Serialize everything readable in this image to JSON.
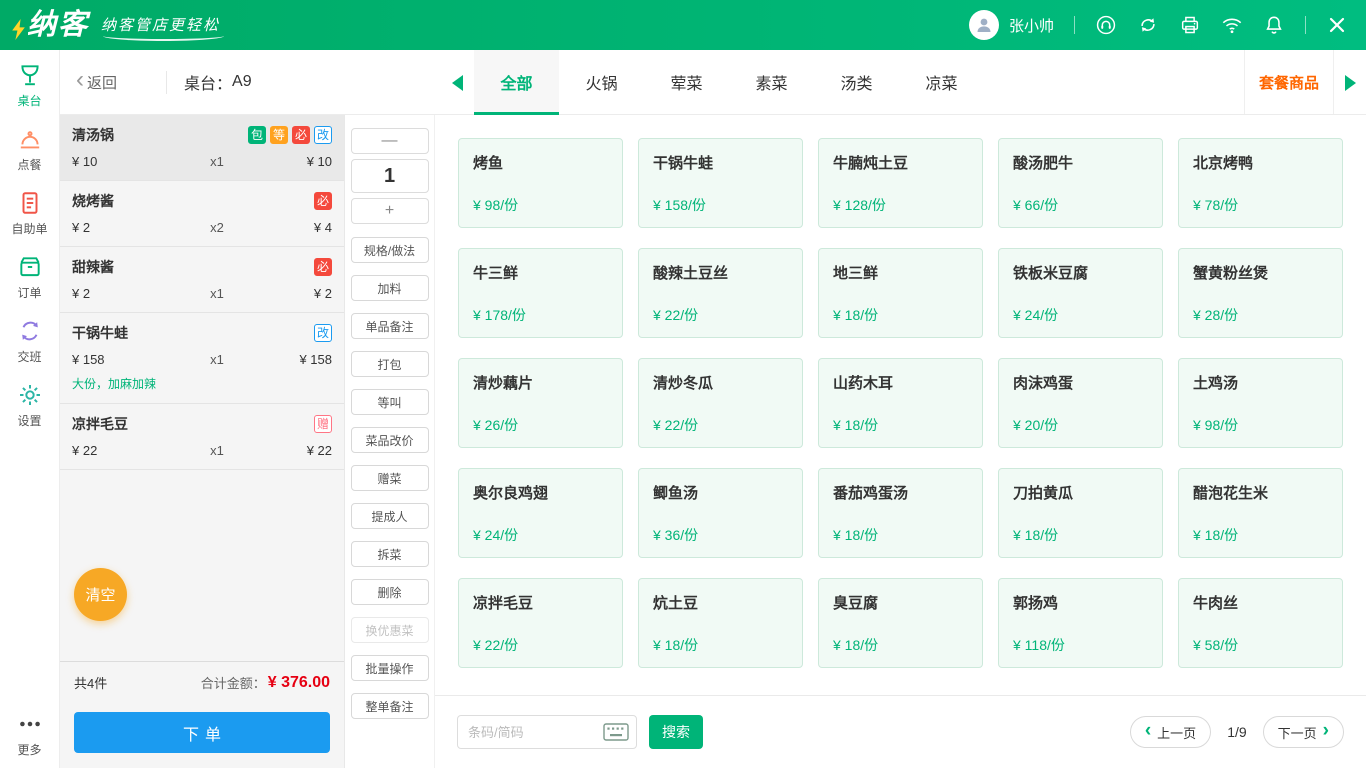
{
  "topbar": {
    "brand": "纳客",
    "slogan": "纳客管店更轻松",
    "user": "张小帅"
  },
  "sidebar": {
    "items": [
      {
        "label": "桌台",
        "active": true
      },
      {
        "label": "点餐"
      },
      {
        "label": "自助单"
      },
      {
        "label": "订单"
      },
      {
        "label": "交班"
      },
      {
        "label": "设置"
      },
      {
        "label": "更多"
      }
    ]
  },
  "header": {
    "back_label": "返回",
    "table_label": "桌台：",
    "table_no": "A9",
    "tabs": [
      {
        "label": "全部",
        "active": true
      },
      {
        "label": "火锅"
      },
      {
        "label": "荤菜"
      },
      {
        "label": "素菜"
      },
      {
        "label": "汤类"
      },
      {
        "label": "凉菜"
      }
    ],
    "combo_label": "套餐商品"
  },
  "badge_styles": {
    "包": "green",
    "等": "orange",
    "必": "red",
    "改": "blue",
    "赠": "pink"
  },
  "order": {
    "items": [
      {
        "name": "清汤锅",
        "badges": [
          "包",
          "等",
          "必",
          "改"
        ],
        "price": "¥ 10",
        "qty": "x1",
        "total": "¥ 10",
        "selected": true
      },
      {
        "name": "烧烤酱",
        "badges": [
          "必"
        ],
        "price": "¥ 2",
        "qty": "x2",
        "total": "¥ 4"
      },
      {
        "name": "甜辣酱",
        "badges": [
          "必"
        ],
        "price": "¥ 2",
        "qty": "x1",
        "total": "¥ 2"
      },
      {
        "name": "干锅牛蛙",
        "badges": [
          "改"
        ],
        "price": "¥ 158",
        "qty": "x1",
        "total": "¥ 158",
        "note": "大份，加麻加辣"
      },
      {
        "name": "凉拌毛豆",
        "badges": [
          "赠"
        ],
        "price": "¥ 22",
        "qty": "x1",
        "total": "¥ 22"
      }
    ],
    "clear_label": "清空",
    "count_label": "共4件",
    "total_label": "合计金额：",
    "total_amount": "¥ 376.00",
    "submit_label": "下单"
  },
  "actions": {
    "minus_label": "—",
    "qty_value": "1",
    "plus_label": "+",
    "buttons": [
      {
        "label": "规格/做法"
      },
      {
        "label": "加料"
      },
      {
        "label": "单品备注"
      },
      {
        "label": "打包"
      },
      {
        "label": "等叫"
      },
      {
        "label": "菜品改价"
      },
      {
        "label": "赠菜"
      },
      {
        "label": "提成人"
      },
      {
        "label": "拆菜"
      },
      {
        "label": "删除"
      },
      {
        "label": "换优惠菜",
        "disabled": true
      },
      {
        "label": "批量操作"
      },
      {
        "label": "整单备注"
      }
    ]
  },
  "menu": {
    "items": [
      {
        "name": "烤鱼",
        "price": "¥ 98/份"
      },
      {
        "name": "干锅牛蛙",
        "price": "¥ 158/份"
      },
      {
        "name": "牛腩炖土豆",
        "price": "¥ 128/份"
      },
      {
        "name": "酸汤肥牛",
        "price": "¥ 66/份"
      },
      {
        "name": "北京烤鸭",
        "price": "¥ 78/份"
      },
      {
        "name": "牛三鲜",
        "price": "¥ 178/份"
      },
      {
        "name": "酸辣土豆丝",
        "price": "¥ 22/份"
      },
      {
        "name": "地三鲜",
        "price": "¥ 18/份"
      },
      {
        "name": "铁板米豆腐",
        "price": "¥ 24/份"
      },
      {
        "name": "蟹黄粉丝煲",
        "price": "¥ 28/份"
      },
      {
        "name": "清炒藕片",
        "price": "¥ 26/份"
      },
      {
        "name": "清炒冬瓜",
        "price": "¥ 22/份"
      },
      {
        "name": "山药木耳",
        "price": "¥ 18/份"
      },
      {
        "name": "肉沫鸡蛋",
        "price": "¥ 20/份"
      },
      {
        "name": "土鸡汤",
        "price": "¥ 98/份"
      },
      {
        "name": "奥尔良鸡翅",
        "price": "¥ 24/份"
      },
      {
        "name": "鲫鱼汤",
        "price": "¥ 36/份"
      },
      {
        "name": "番茄鸡蛋汤",
        "price": "¥ 18/份"
      },
      {
        "name": "刀拍黄瓜",
        "price": "¥ 18/份"
      },
      {
        "name": "醋泡花生米",
        "price": "¥ 18/份"
      },
      {
        "name": "凉拌毛豆",
        "price": "¥ 22/份"
      },
      {
        "name": "炕土豆",
        "price": "¥ 18/份"
      },
      {
        "name": "臭豆腐",
        "price": "¥ 18/份"
      },
      {
        "name": "郭扬鸡",
        "price": "¥ 118/份"
      },
      {
        "name": "牛肉丝",
        "price": "¥ 58/份"
      }
    ]
  },
  "footer": {
    "search_placeholder": "条码/简码",
    "search_label": "搜索",
    "prev_label": "上一页",
    "page_indicator": "1/9",
    "next_label": "下一页"
  },
  "colors": {
    "brand_green": "#00b478",
    "blue": "#1b9bf0",
    "price_red": "#e60012",
    "combo_orange": "#ff6600"
  }
}
